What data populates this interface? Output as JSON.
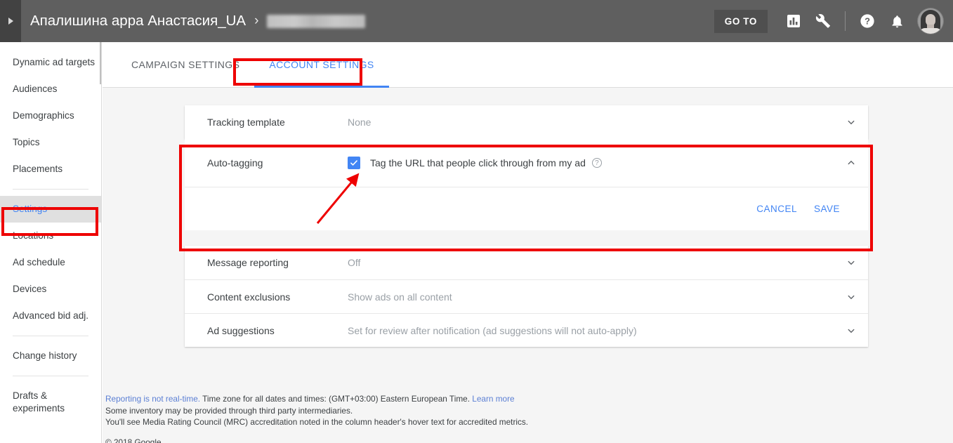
{
  "header": {
    "nav_toggle_icon": "expand-arrow-icon",
    "breadcrumb": {
      "account": "Апалишина арра Анастасия_UA",
      "separator": "›",
      "redacted_label": ""
    },
    "goto_label": "GO TO",
    "icons": [
      {
        "name": "reports-bar-chart-icon"
      },
      {
        "name": "tools-wrench-icon"
      },
      {
        "name": "help-question-icon"
      },
      {
        "name": "notifications-bell-icon"
      }
    ],
    "avatar_alt": "account avatar"
  },
  "sidebar": {
    "items": [
      {
        "label": "Dynamic ad targets",
        "active": false
      },
      {
        "label": "Audiences",
        "active": false
      },
      {
        "label": "Demographics",
        "active": false
      },
      {
        "label": "Topics",
        "active": false
      },
      {
        "label": "Placements",
        "active": false
      },
      {
        "label": "Settings",
        "active": true
      },
      {
        "label": "Locations",
        "active": false
      },
      {
        "label": "Ad schedule",
        "active": false
      },
      {
        "label": "Devices",
        "active": false
      },
      {
        "label": "Advanced bid adj.",
        "active": false
      },
      {
        "label": "Change history",
        "active": false
      },
      {
        "label": "Drafts & experiments",
        "active": false
      }
    ]
  },
  "tabs": [
    {
      "label": "CAMPAIGN SETTINGS",
      "active": false
    },
    {
      "label": "ACCOUNT SETTINGS",
      "active": true
    }
  ],
  "settings": {
    "tracking_template": {
      "label": "Tracking template",
      "value": "None",
      "chevron": "chevron-down-icon"
    },
    "auto_tagging": {
      "label": "Auto-tagging",
      "checkbox_checked": true,
      "checkbox_label": "Tag the URL that people click through from my ad",
      "help_icon": "?",
      "chevron": "chevron-up-icon",
      "cancel_label": "CANCEL",
      "save_label": "SAVE"
    },
    "rows": [
      {
        "label": "Message reporting",
        "value": "Off",
        "chevron": "chevron-down-icon"
      },
      {
        "label": "Content exclusions",
        "value": "Show ads on all content",
        "chevron": "chevron-down-icon"
      },
      {
        "label": "Ad suggestions",
        "value": "Set for review after notification (ad suggestions will not auto-apply)",
        "chevron": "chevron-down-icon"
      }
    ]
  },
  "footer": {
    "line1_link": "Reporting is not real-time.",
    "line1_text": " Time zone for all dates and times: (GMT+03:00) Eastern European Time. ",
    "line1_learn_more": "Learn more",
    "line2": "Some inventory may be provided through third party intermediaries.",
    "line3": "You'll see Media Rating Council (MRC) accreditation noted in the column header's hover text for accredited metrics.",
    "copyright": "© 2018 Google"
  },
  "annotations": {
    "accent_color": "#ee0000",
    "boxes": [
      "settings-sidebar-item",
      "account-settings-tab",
      "auto-tagging-card"
    ],
    "arrow": "points-to-auto-tagging-checkbox"
  },
  "colors": {
    "brand_blue": "#4285f4",
    "header_grey": "#5f5f5f",
    "annotation_red": "#ee0000",
    "content_bg": "#f5f5f5"
  }
}
